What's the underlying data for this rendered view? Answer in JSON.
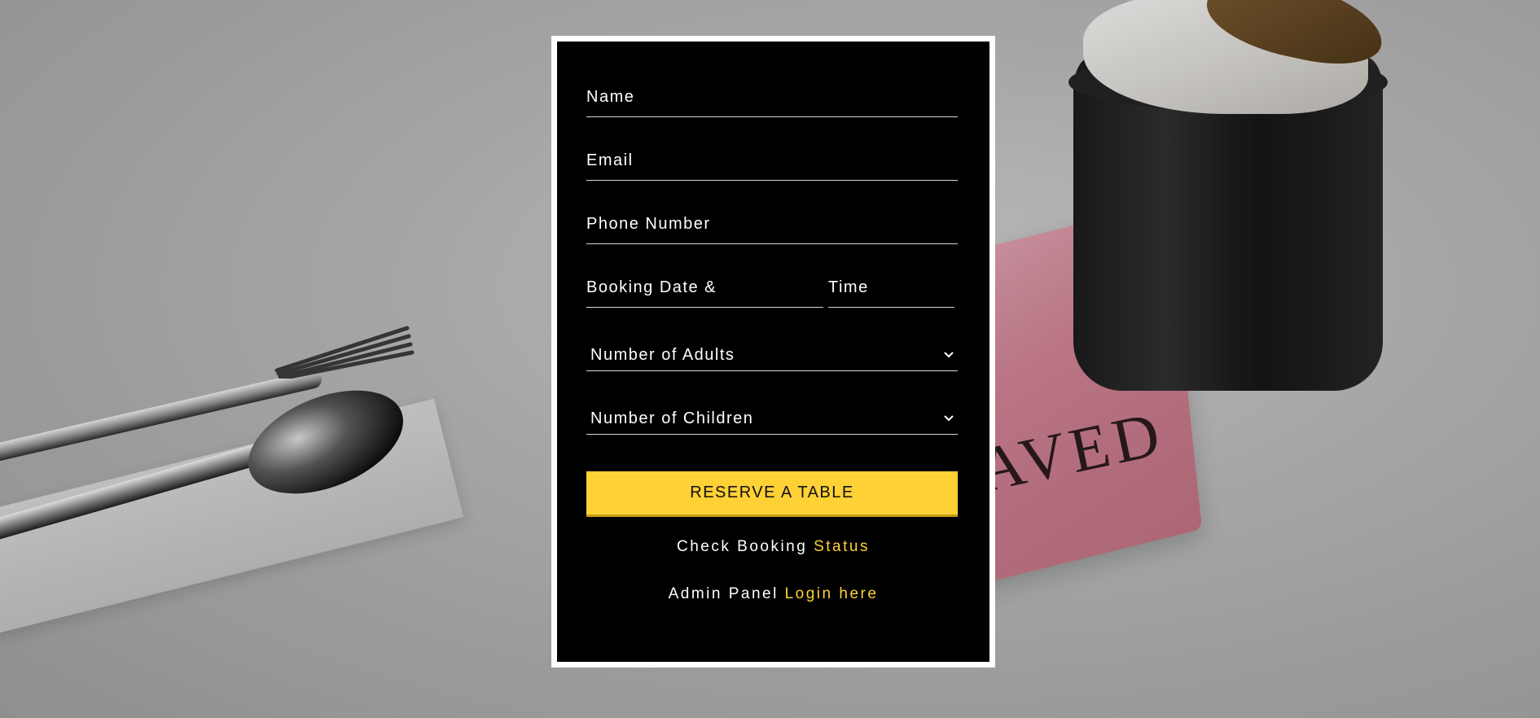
{
  "form": {
    "name_placeholder": "Name",
    "email_placeholder": "Email",
    "phone_placeholder": "Phone Number",
    "date_placeholder": "Booking Date &",
    "time_placeholder": "Time",
    "adults_select": "Number of Adults",
    "children_select": "Number of Children",
    "reserve_label": "RESERVE A TABLE"
  },
  "links": {
    "status_prefix": "Check Booking",
    "status_link": "Status",
    "admin_prefix": "Admin Panel",
    "admin_link": "Login here"
  },
  "background": {
    "sign_text": "AVED"
  },
  "colors": {
    "accent": "#fed136",
    "card": "#000000",
    "border": "#ffffff"
  },
  "icons": {
    "select_chevron": "chevron-down-icon"
  }
}
